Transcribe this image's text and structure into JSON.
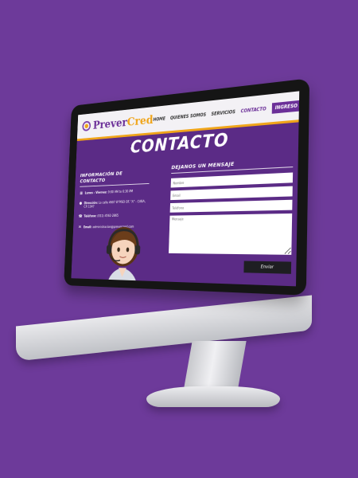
{
  "site": {
    "logo": {
      "name_a": "Prever",
      "name_b": "Cred"
    },
    "nav": [
      {
        "label": "HOME"
      },
      {
        "label": "QUIENES SOMOS"
      },
      {
        "label": "SERVICIOS"
      },
      {
        "label": "CONTACTO"
      },
      {
        "label": "INGRESO A CONVERSIONES"
      }
    ],
    "page_title": "CONTACTO",
    "info": {
      "heading": "INFORMACIÓN DE CONTACTO",
      "rows": [
        {
          "icon": "calendar-icon",
          "label": "Lunes - Viernes:",
          "value": "9:00 AM to 6:30 PM"
        },
        {
          "icon": "location-icon",
          "label": "Dirección:",
          "value": "La calle 4607 8°PISO OF. \"A\" - CABA, CP. 1047"
        },
        {
          "icon": "phone-icon",
          "label": "Teléfono:",
          "value": "(011) 4562-2865"
        },
        {
          "icon": "email-icon",
          "label": "Email:",
          "value": "administracion@prevercred.com"
        }
      ]
    },
    "form": {
      "heading": "DEJANOS UN MENSAJE",
      "fields": [
        {
          "placeholder": "Nombre"
        },
        {
          "placeholder": "Email"
        },
        {
          "placeholder": "Teléfono"
        },
        {
          "placeholder": "Mensaje"
        }
      ],
      "submit_label": "Enviar"
    },
    "colors": {
      "brand_purple": "#6b2f98",
      "accent_orange": "#f0a51a",
      "background": "#6d3a9a"
    }
  }
}
